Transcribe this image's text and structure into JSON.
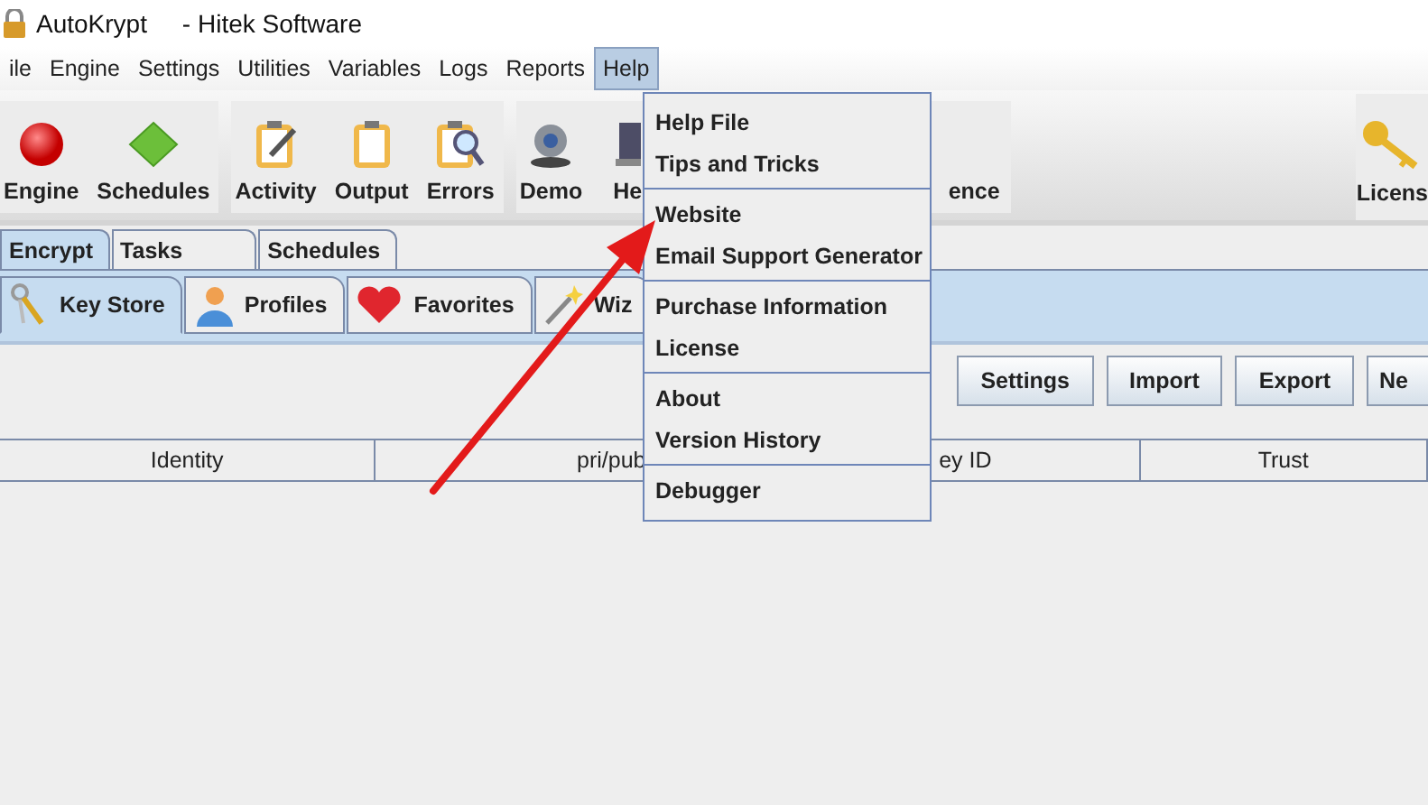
{
  "window": {
    "title": "AutoKrypt     - Hitek Software"
  },
  "menu_bar": [
    {
      "label": "ile",
      "selected": false
    },
    {
      "label": "Engine",
      "selected": false
    },
    {
      "label": "Settings",
      "selected": false
    },
    {
      "label": "Utilities",
      "selected": false
    },
    {
      "label": "Variables",
      "selected": false
    },
    {
      "label": "Logs",
      "selected": false
    },
    {
      "label": "Reports",
      "selected": false
    },
    {
      "label": "Help",
      "selected": true
    }
  ],
  "toolbar": {
    "groups": [
      [
        {
          "label": "Engine"
        },
        {
          "label": "Schedules"
        }
      ],
      [
        {
          "label": "Activity"
        },
        {
          "label": "Output"
        },
        {
          "label": "Errors"
        }
      ],
      [
        {
          "label": "Demo"
        },
        {
          "label": "He"
        },
        {
          "label": "ence"
        }
      ]
    ],
    "right": [
      {
        "label": "Licens"
      }
    ]
  },
  "tabs": [
    {
      "label": "Encrypt",
      "selected": true
    },
    {
      "label": "Tasks",
      "selected": false
    },
    {
      "label": "Schedules",
      "selected": false
    }
  ],
  "sub_tabs": [
    {
      "label": "Key Store",
      "selected": true
    },
    {
      "label": "Profiles",
      "selected": false
    },
    {
      "label": "Favorites",
      "selected": false
    },
    {
      "label": "Wiz",
      "selected": false
    }
  ],
  "buttons": [
    "Settings",
    "Import",
    "Export",
    "Ne"
  ],
  "table": {
    "columns": [
      "Identity",
      "pri/pub",
      "ey ID",
      "Trust"
    ]
  },
  "help_menu": {
    "groups": [
      [
        "Help File",
        "Tips and Tricks"
      ],
      [
        "Website",
        "Email Support Generator"
      ],
      [
        "Purchase Information",
        "License"
      ],
      [
        "About",
        "Version History"
      ],
      [
        "Debugger"
      ]
    ]
  }
}
